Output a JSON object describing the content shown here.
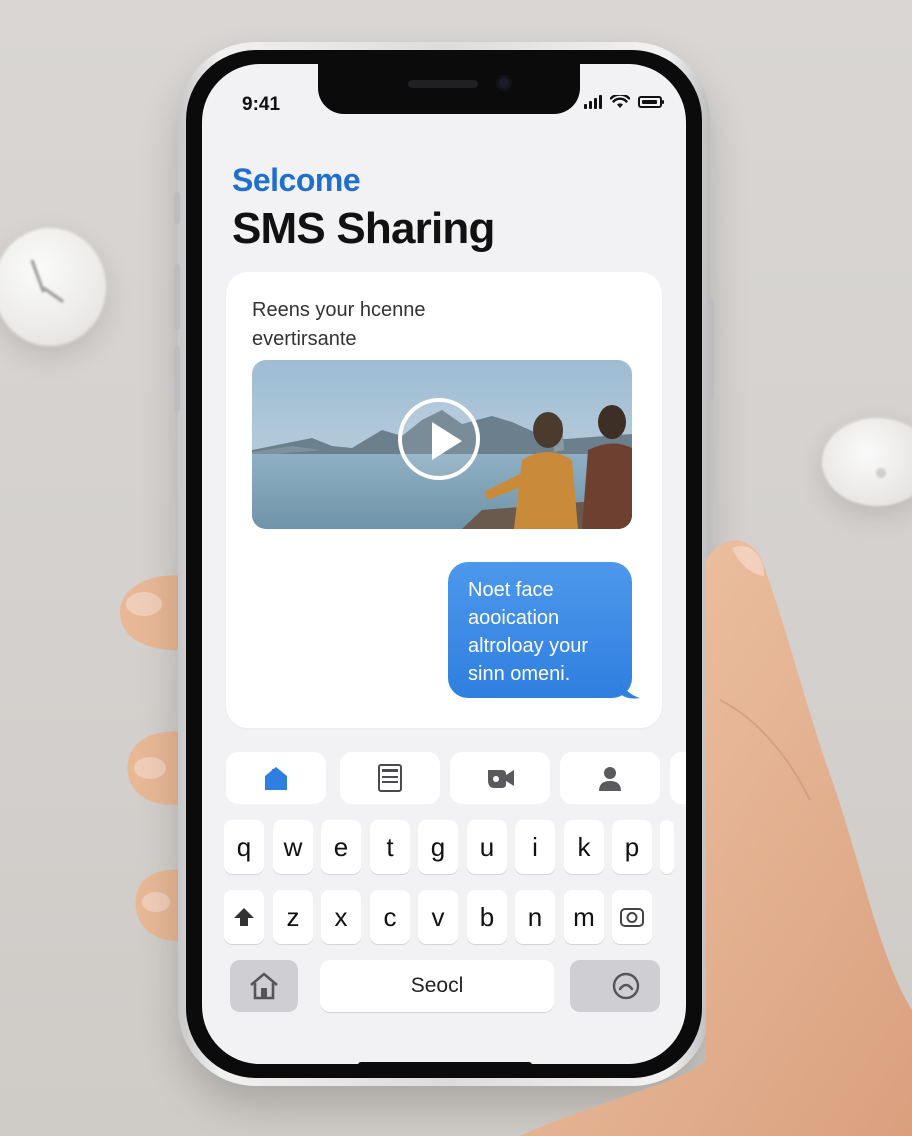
{
  "status": {
    "time": "9:41"
  },
  "header": {
    "welcome": "Selcome",
    "title": "SMS Sharing"
  },
  "message_card": {
    "text_line1": "Reens your hcenne",
    "text_line2": "evertirsante",
    "video": {
      "play_icon": "play-icon"
    },
    "bubble": {
      "line1": "Noet face",
      "line2": "aooication",
      "line3": "altroloay your",
      "line4": "sinn omeni."
    }
  },
  "quick_actions": [
    {
      "icon": "home-icon"
    },
    {
      "icon": "document-icon"
    },
    {
      "icon": "video-camera-icon"
    },
    {
      "icon": "person-icon"
    }
  ],
  "keyboard": {
    "row1": [
      "q",
      "w",
      "e",
      "t",
      "g",
      "u",
      "i",
      "k",
      "p"
    ],
    "row2": [
      "z",
      "x",
      "c",
      "v",
      "b",
      "n",
      "m"
    ],
    "space_label": "Seocl"
  },
  "colors": {
    "accent": "#1f6fcf",
    "bubble": "#3a8ae6"
  }
}
